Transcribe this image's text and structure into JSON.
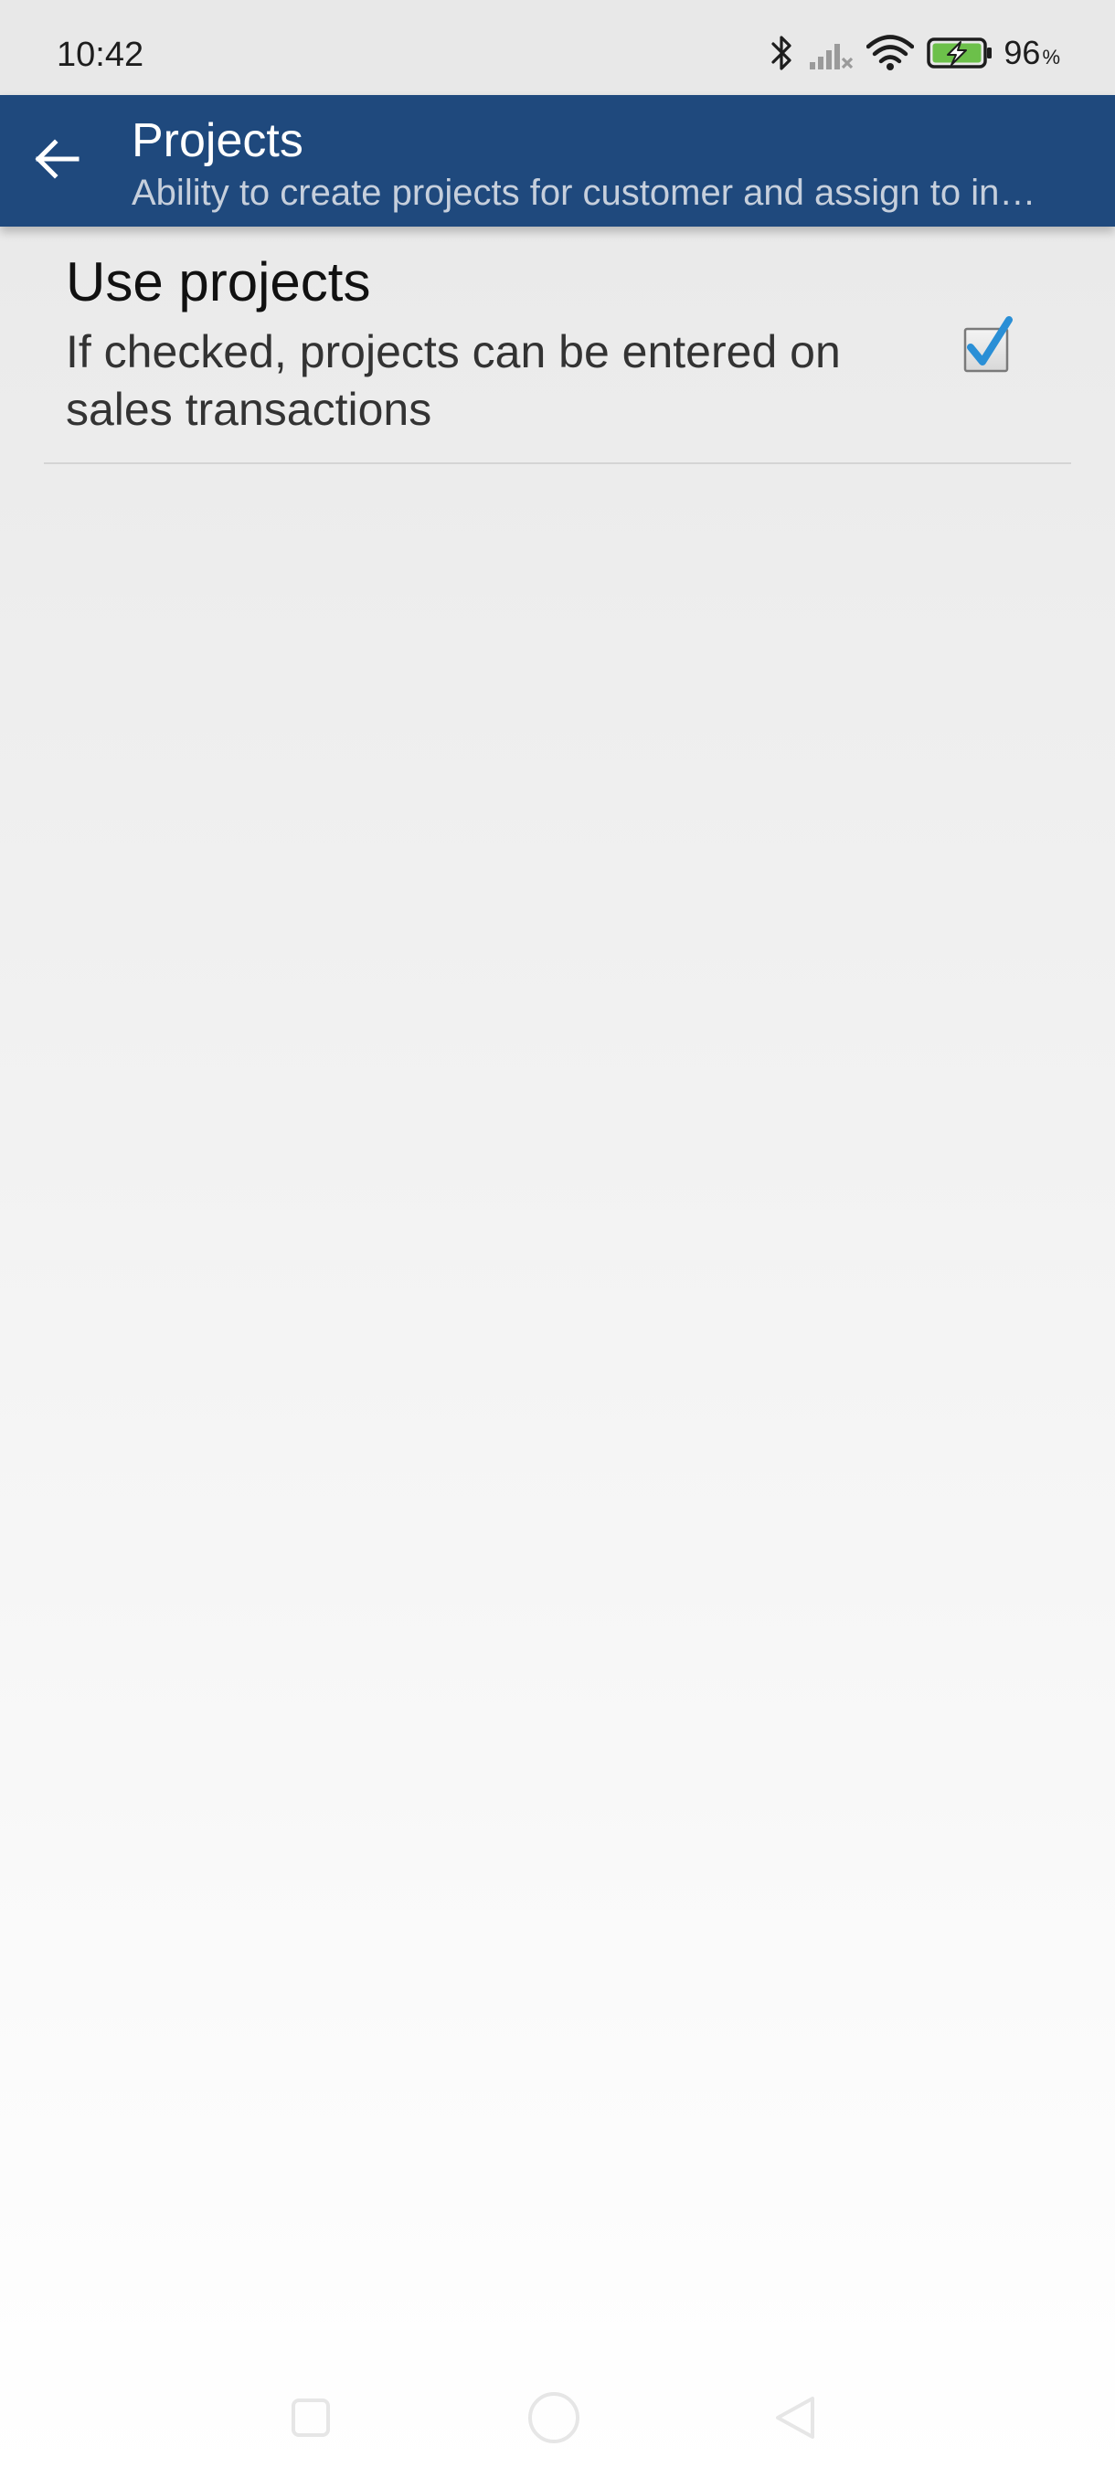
{
  "status_bar": {
    "time": "10:42",
    "battery_percent": "96",
    "battery_percent_sign": "%",
    "icons": [
      "bluetooth-icon",
      "cellular-signal-icon",
      "wifi-icon",
      "battery-charging-icon"
    ]
  },
  "toolbar": {
    "title": "Projects",
    "subtitle": "Ability to create projects for customer and assign to in…",
    "back_icon": "arrow-left-icon"
  },
  "preference": {
    "title": "Use projects",
    "summary": "If checked, projects can be entered on sales transactions",
    "checked": true
  },
  "nav_bar": {
    "icons": [
      "recents-square-icon",
      "home-circle-icon",
      "back-triangle-icon"
    ]
  },
  "colors": {
    "toolbar": "#1f497d",
    "checkmark": "#2a8fd6",
    "battery_fill": "#6cc04a"
  }
}
